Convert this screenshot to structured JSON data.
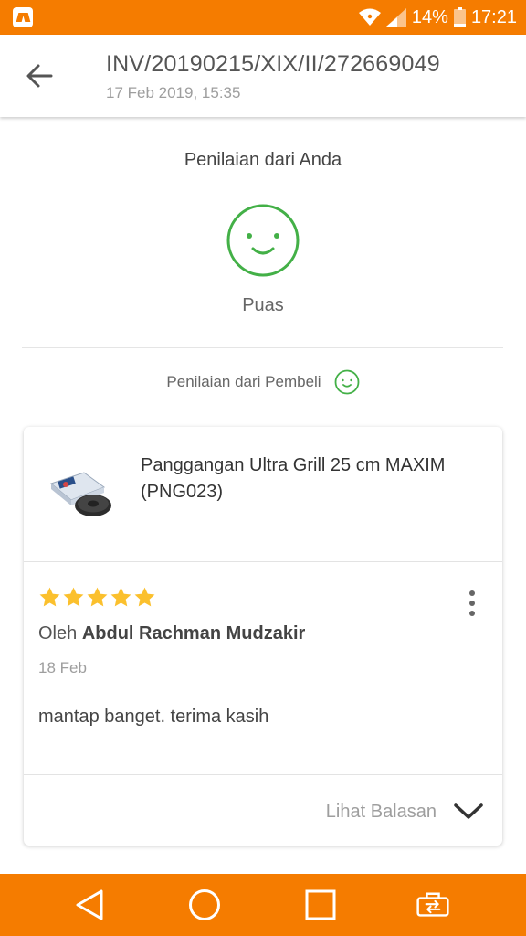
{
  "status_bar": {
    "battery": "14%",
    "time": "17:21",
    "icons": [
      "app-notification-icon",
      "wifi-icon",
      "signal-icon",
      "battery-icon"
    ]
  },
  "header": {
    "invoice": "INV/20190215/XIX/II/272669049",
    "date": "17 Feb 2019, 15:35",
    "back_icon": "arrow-back-icon"
  },
  "rating_you": {
    "title": "Penilaian dari Anda",
    "result": "Puas",
    "icon": "smile-face-icon"
  },
  "buyer_rating": {
    "label": "Penilaian dari Pembeli",
    "icon": "smile-face-icon"
  },
  "review_card": {
    "product_name": "Panggangan Ultra Grill 25 cm MAXIM (PNG023)",
    "stars": 5,
    "by_prefix": "Oleh",
    "reviewer": "Abdul Rachman Mudzakir",
    "date": "18 Feb",
    "text": "mantap banget. terima kasih",
    "replies_label": "Lihat Balasan"
  },
  "colors": {
    "accent_orange": "#f57c00",
    "smile_green": "#43b047",
    "star_gold": "#fbc02d"
  },
  "nav_icons": [
    "back-triangle-icon",
    "home-circle-icon",
    "recents-square-icon",
    "screen-rotate-icon"
  ]
}
